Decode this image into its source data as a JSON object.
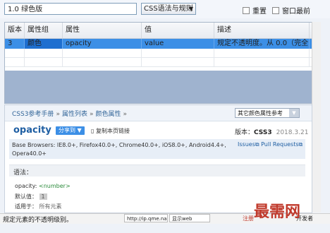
{
  "toolbar": {
    "search_value": "1.0 绿色版",
    "mode_select": "CSS语法与规则",
    "reset_label": "重置",
    "window_top_label": "窗口最前"
  },
  "grid": {
    "headers": [
      "版本",
      "属性组",
      "属性",
      "值",
      "描述"
    ],
    "selected_row": [
      "3",
      "颜色",
      "opacity",
      "value",
      "规定不透明度。从 0.0（完全..."
    ]
  },
  "doc": {
    "breadcrumb": [
      "CSS3参考手册",
      "属性列表",
      "颜色属性"
    ],
    "other_ref": "其它颜色属性参考",
    "title": "opacity",
    "share": "分享到",
    "copy_link": "复制本页链接",
    "version_label": "版本：",
    "version_value": "CSS3",
    "date": "2018.3.21",
    "compat": "Base Browsers: IE8.0+, Firefox40.0+, Chrome40.0+, iOS8.0+, Android4.4+, Opera40.0+",
    "issues": "Issues",
    "pull_requests": "Pull Requests",
    "syntax_heading": "语法：",
    "syntax_line_prop": "opacity:",
    "syntax_line_type": "<number>",
    "default_label": "默认值：",
    "default_value": "1",
    "applies_label": "适用于：",
    "applies_value": "所有元素"
  },
  "status": {
    "desc": "规定元素的不透明级别。",
    "url": "http://ip.qme.na",
    "display": "显示web",
    "register": "注册",
    "flag": "开发者"
  },
  "watermark": "最需网"
}
